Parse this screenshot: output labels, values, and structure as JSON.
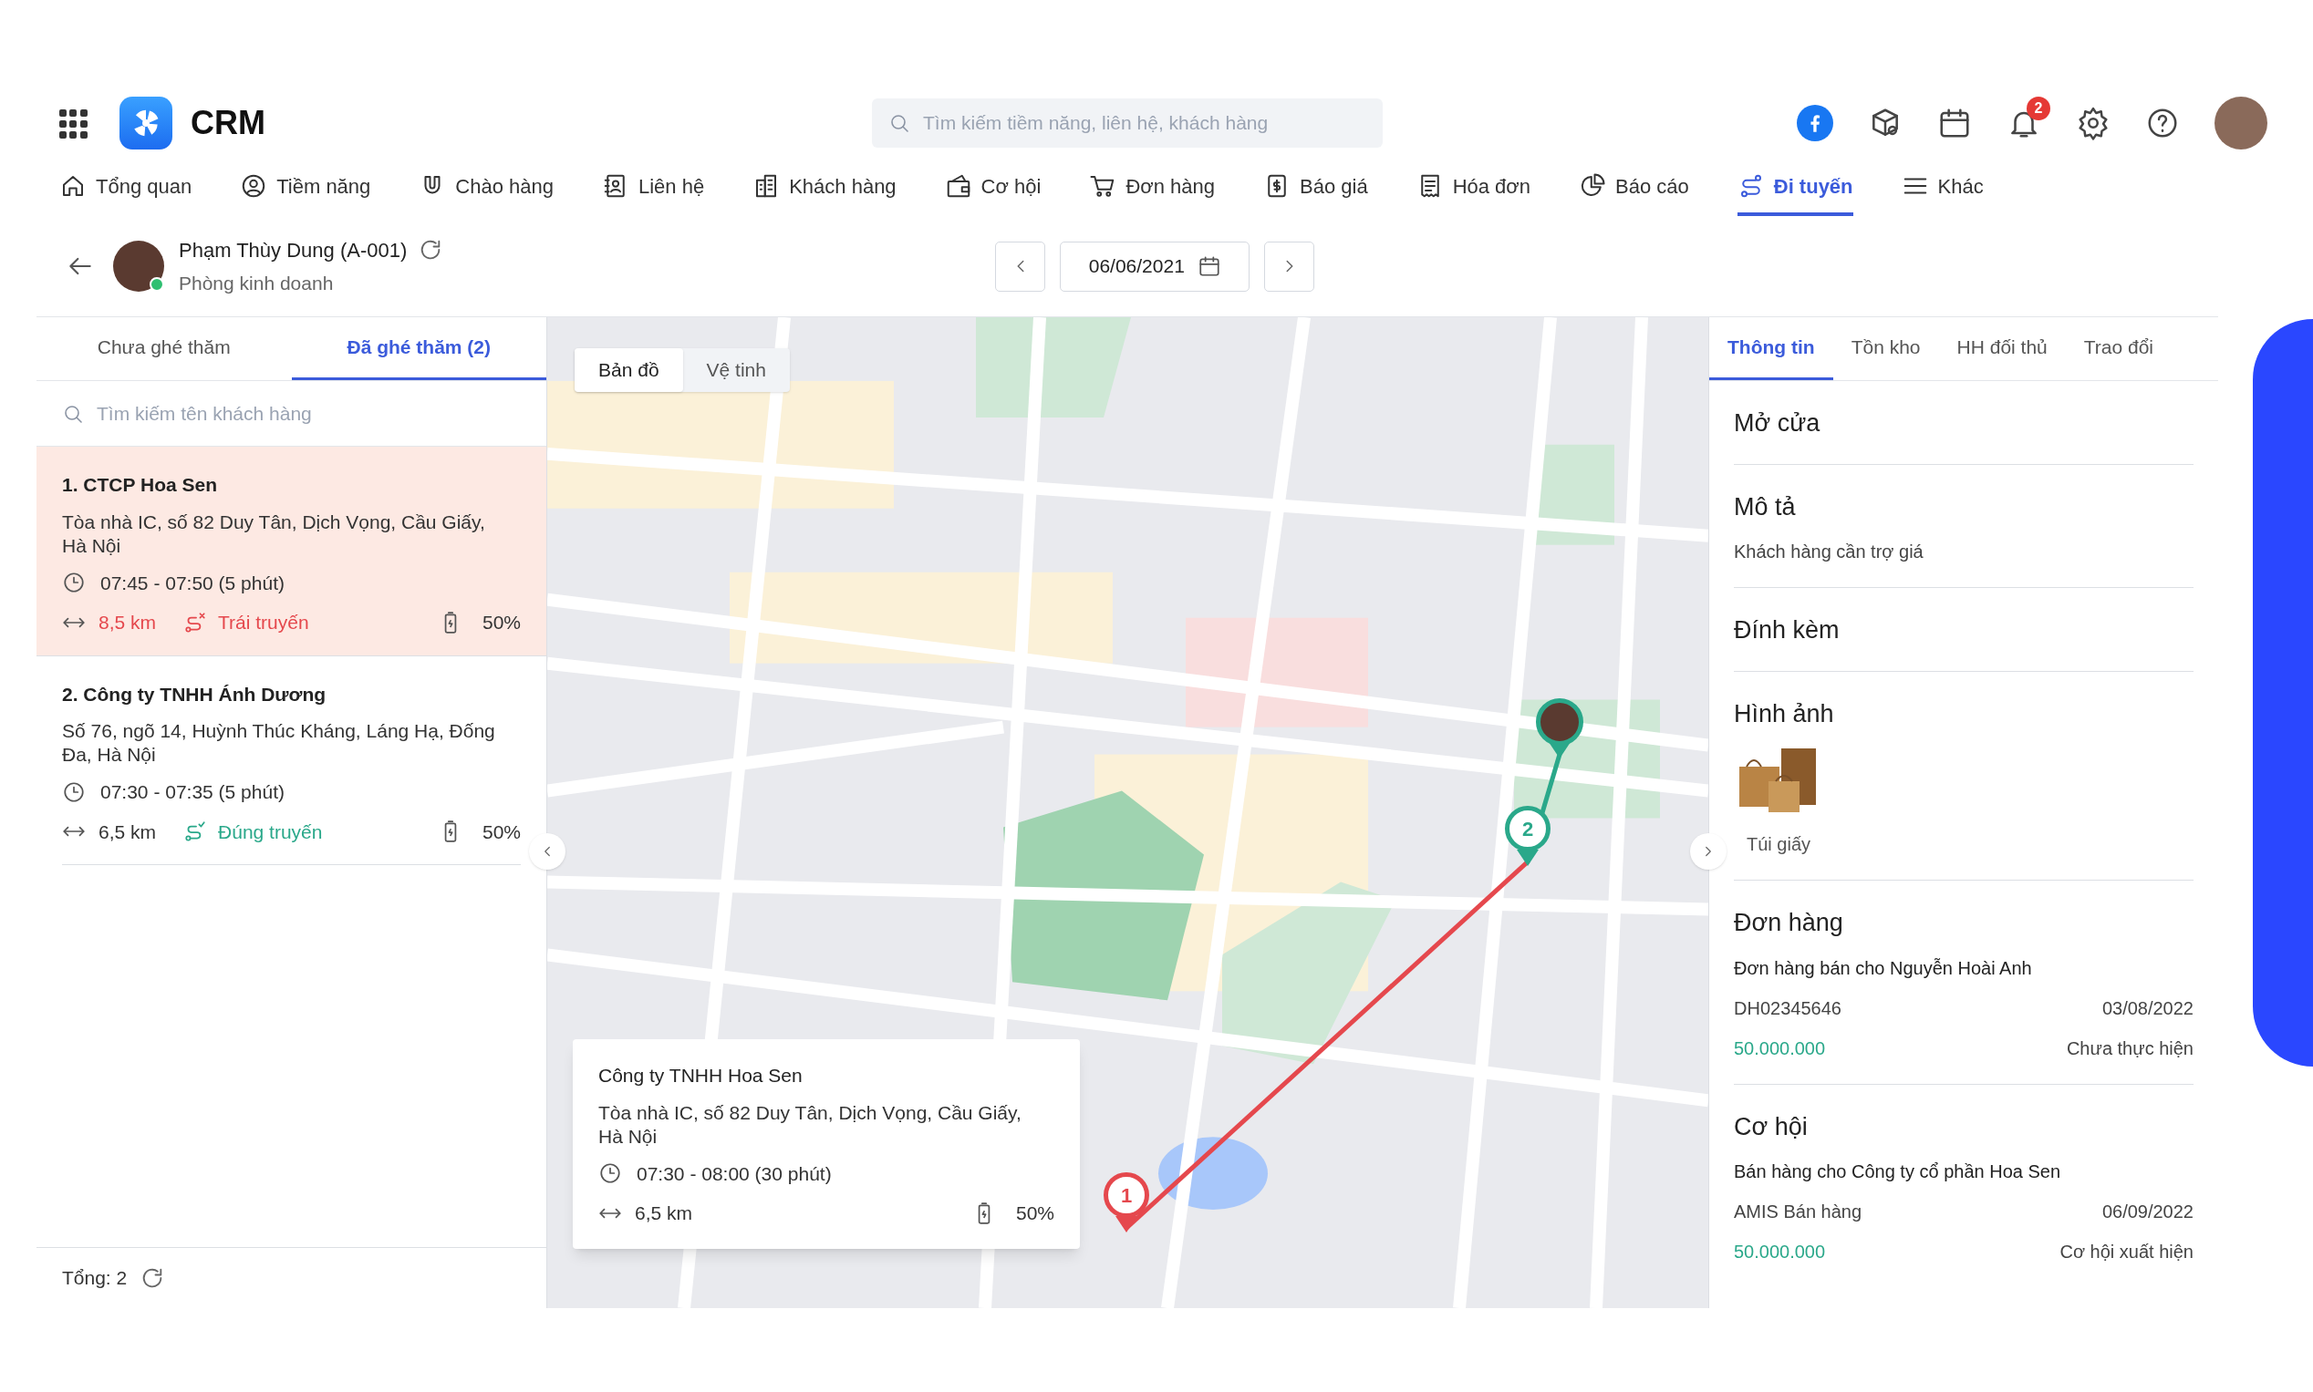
{
  "header": {
    "app_name": "CRM",
    "search": {
      "placeholder": "Tìm kiếm tiềm năng, liên hệ, khách hàng"
    },
    "notification_count": "2"
  },
  "nav": [
    {
      "label": "Tổng quan",
      "selected": false
    },
    {
      "label": "Tiềm năng",
      "selected": false
    },
    {
      "label": "Chào hàng",
      "selected": false
    },
    {
      "label": "Liên hệ",
      "selected": false
    },
    {
      "label": "Khách hàng",
      "selected": false
    },
    {
      "label": "Cơ hội",
      "selected": false
    },
    {
      "label": "Đơn hàng",
      "selected": false
    },
    {
      "label": "Báo giá",
      "selected": false
    },
    {
      "label": "Hóa đơn",
      "selected": false
    },
    {
      "label": "Báo cáo",
      "selected": false
    },
    {
      "label": "Đi tuyến",
      "selected": true
    },
    {
      "label": "Khác",
      "selected": false
    }
  ],
  "employee": {
    "name": "Phạm Thùy Dung (A-001)",
    "department": "Phòng kinh doanh",
    "online": true
  },
  "date": "06/06/2021",
  "left_panel": {
    "tabs": [
      {
        "label": "Chưa ghé thăm",
        "selected": false
      },
      {
        "label": "Đã ghé thăm (2)",
        "selected": true
      }
    ],
    "search": {
      "placeholder": "Tìm kiếm tên khách hàng"
    },
    "visits": [
      {
        "title": "1. CTCP Hoa Sen",
        "address": "Tòa nhà IC, số 82 Duy Tân, Dịch Vọng, Cầu Giấy, Hà Nội",
        "time": "07:45 - 07:50 (5 phút)",
        "distance": "8,5 km",
        "route_status": "Trái truyến",
        "on_route": false,
        "battery": "50%",
        "selected": true
      },
      {
        "title": "2. Công ty TNHH Ánh Dương",
        "address": "Số 76, ngõ 14, Huỳnh Thúc Kháng, Láng Hạ, Đống Đa, Hà Nội",
        "time": "07:30 - 07:35 (5 phút)",
        "distance": "6,5 km",
        "route_status": "Đúng truyến",
        "on_route": true,
        "battery": "50%",
        "selected": false
      }
    ],
    "total": "Tổng: 2"
  },
  "map": {
    "tabs": [
      {
        "label": "Bản đồ",
        "selected": true
      },
      {
        "label": "Vệ tinh",
        "selected": false
      }
    ],
    "markers": [
      {
        "kind": "stop",
        "label": "1",
        "color": "#e5484d"
      },
      {
        "kind": "stop",
        "label": "2",
        "color": "#2aa88a"
      },
      {
        "kind": "person",
        "color": "#2aa88a"
      }
    ],
    "popup": {
      "title": "Công ty TNHH Hoa Sen",
      "address": "Tòa nhà IC, số 82 Duy Tân, Dịch Vọng, Cầu Giấy, Hà Nội",
      "time": "07:30 - 08:00 (30 phút)",
      "distance": "6,5 km",
      "battery": "50%"
    }
  },
  "right_panel": {
    "tabs": [
      {
        "label": "Thông tin",
        "selected": true
      },
      {
        "label": "Tồn kho",
        "selected": false
      },
      {
        "label": "HH đối thủ",
        "selected": false
      },
      {
        "label": "Trao đổi",
        "selected": false
      }
    ],
    "sections": [
      {
        "kind": "heading",
        "title": "Mở cửa"
      },
      {
        "kind": "text",
        "title": "Mô tả",
        "text": "Khách hàng cần trợ giá"
      },
      {
        "kind": "heading",
        "title": "Đính kèm"
      },
      {
        "kind": "image",
        "title": "Hình ảnh",
        "caption": "Túi giấy"
      },
      {
        "kind": "record",
        "title": "Đơn hàng",
        "name": "Đơn hàng bán cho Nguyễn Hoài Anh",
        "code": "DH02345646",
        "date": "03/08/2022",
        "amount": "50.000.000",
        "status": "Chưa thực hiện"
      },
      {
        "kind": "record",
        "title": "Cơ hội",
        "name": "Bán hàng cho Công ty cổ phần Hoa Sen",
        "code": "AMIS Bán hàng",
        "date": "06/09/2022",
        "amount": "50.000.000",
        "status": "Cơ hội xuất hiện"
      }
    ]
  }
}
